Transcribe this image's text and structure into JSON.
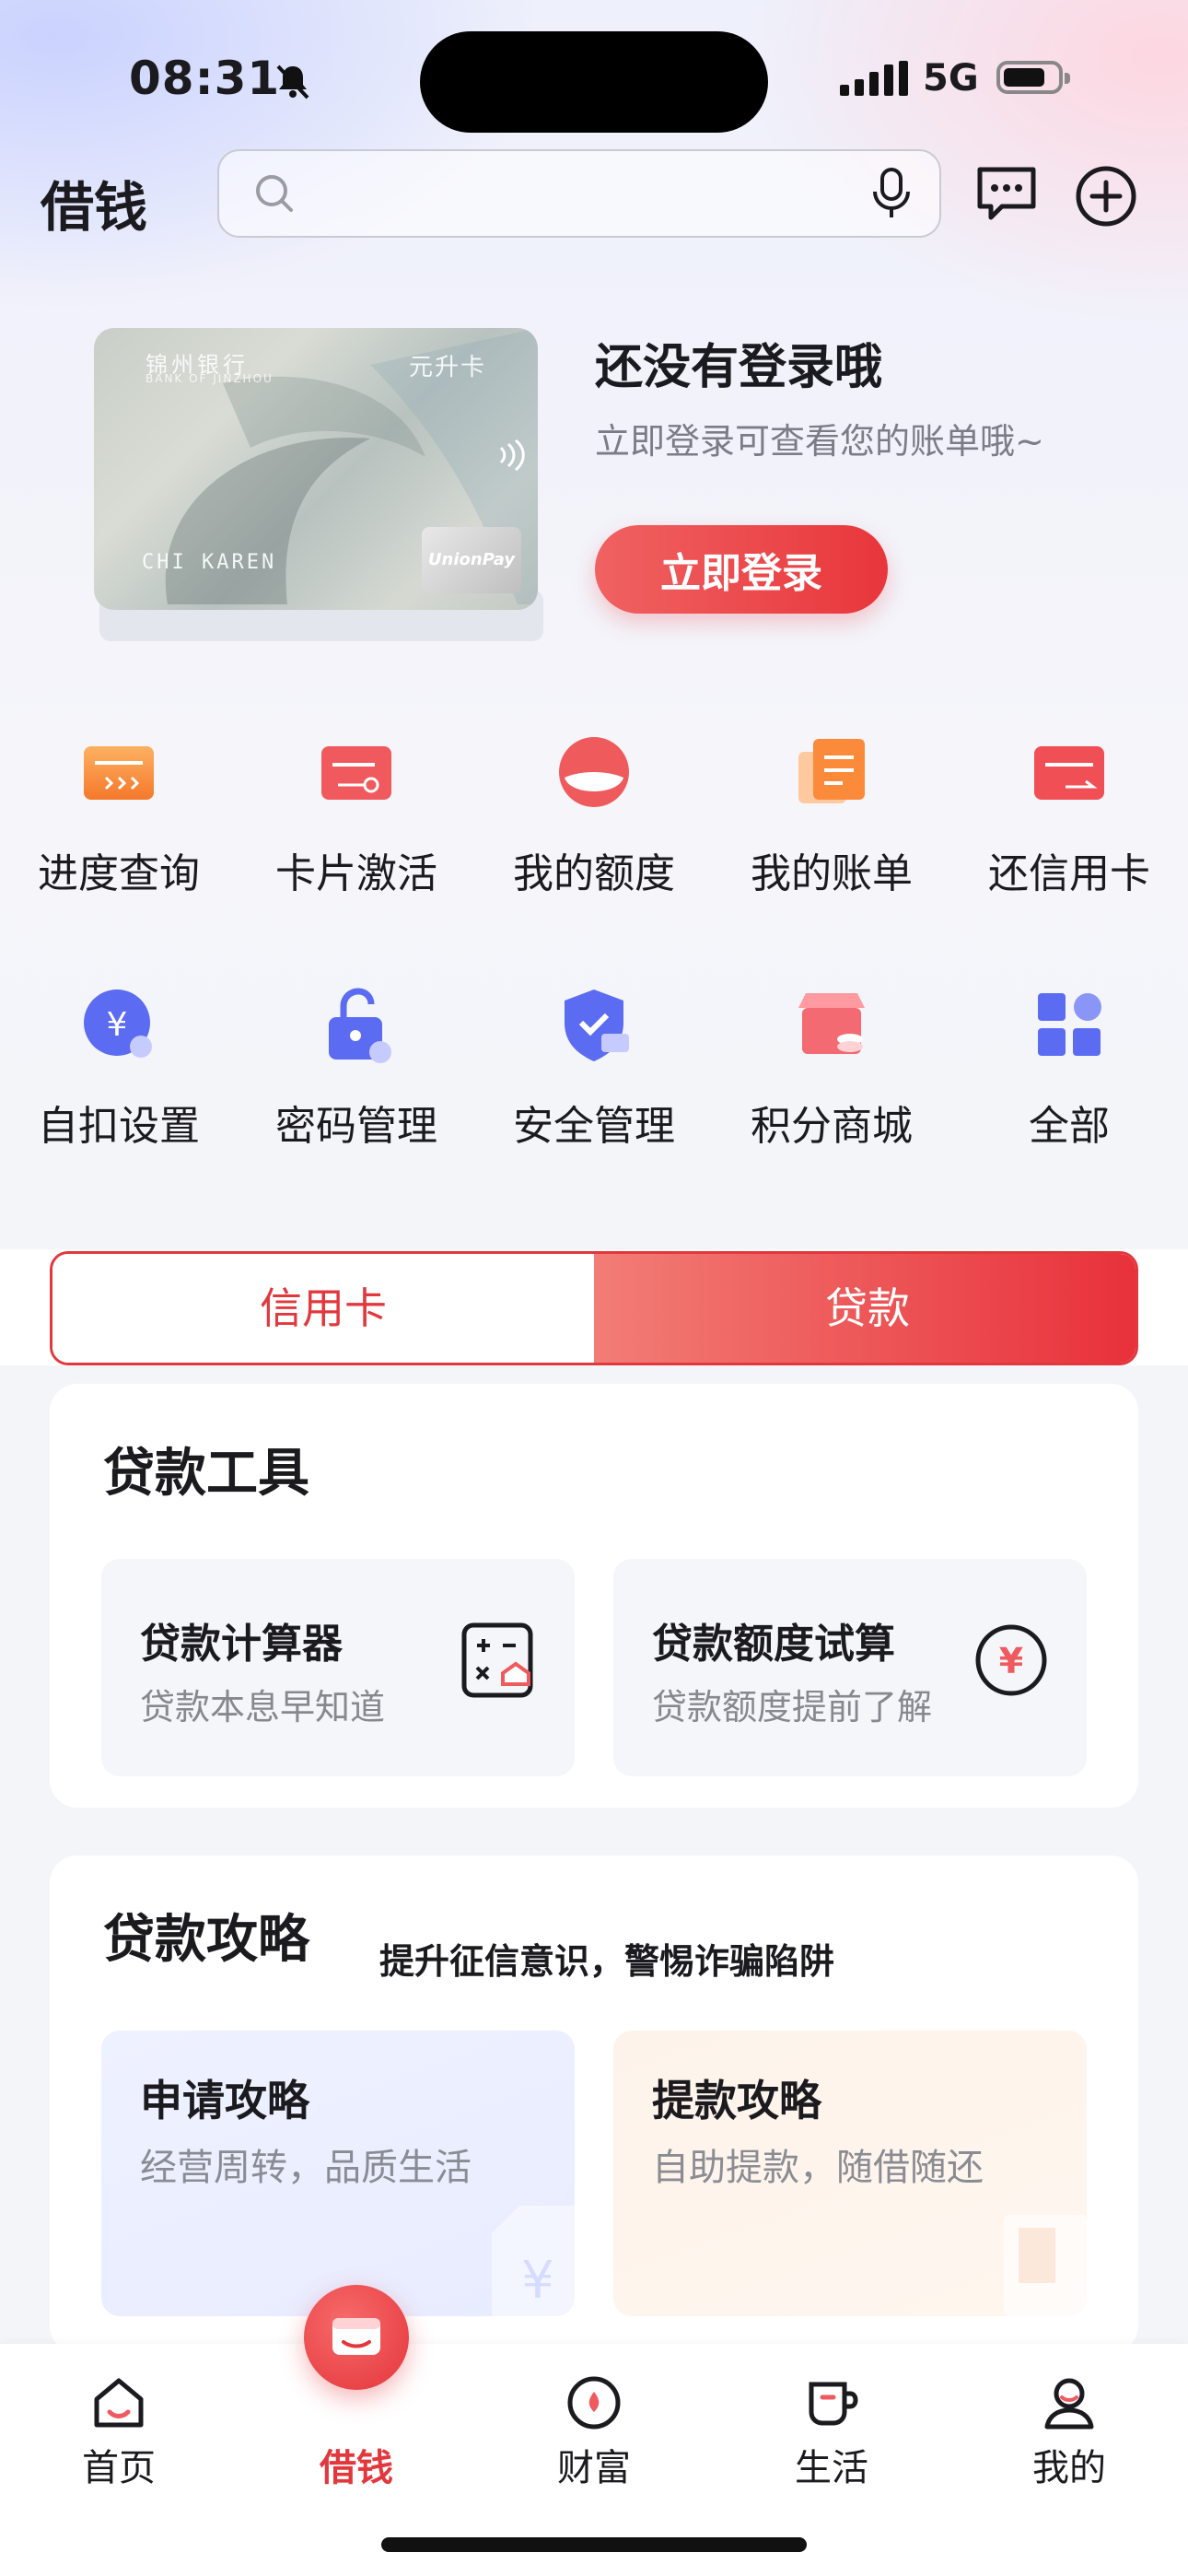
{
  "status_bar": {
    "time": "08:31",
    "network": "5G"
  },
  "header": {
    "title": "借钱",
    "search_placeholder": ""
  },
  "login_card": {
    "card_bank_name": "锦州银行",
    "card_bank_en": "BANK OF JINZHOU",
    "card_tag": "元升卡",
    "card_holder": "CHI KAREN",
    "card_network": "UnionPay 银联",
    "title": "还没有登录哦",
    "subtitle": "立即登录可查看您的账单哦~",
    "button": "立即登录"
  },
  "quick_actions": [
    {
      "label": "进度查询",
      "icon": "progress-query-icon"
    },
    {
      "label": "卡片激活",
      "icon": "card-activate-icon"
    },
    {
      "label": "我的额度",
      "icon": "credit-limit-icon"
    },
    {
      "label": "我的账单",
      "icon": "bill-icon"
    },
    {
      "label": "还信用卡",
      "icon": "repay-card-icon"
    },
    {
      "label": "自扣设置",
      "icon": "auto-debit-icon"
    },
    {
      "label": "密码管理",
      "icon": "password-lock-icon"
    },
    {
      "label": "安全管理",
      "icon": "security-shield-icon"
    },
    {
      "label": "积分商城",
      "icon": "points-mall-icon"
    },
    {
      "label": "全部",
      "icon": "all-grid-icon"
    }
  ],
  "tabs": {
    "credit_card": "信用卡",
    "loan": "贷款",
    "active": "贷款"
  },
  "loan_tools": {
    "title": "贷款工具",
    "items": [
      {
        "title": "贷款计算器",
        "subtitle": "贷款本息早知道",
        "icon": "calculator-icon"
      },
      {
        "title": "贷款额度试算",
        "subtitle": "贷款额度提前了解",
        "icon": "yuan-circle-icon"
      }
    ]
  },
  "loan_guides": {
    "title": "贷款攻略",
    "subtitle": "提升征信意识，警惕诈骗陷阱",
    "items": [
      {
        "title": "申请攻略",
        "subtitle": "经营周转，品质生活"
      },
      {
        "title": "提款攻略",
        "subtitle": "自助提款，随借随还"
      }
    ]
  },
  "bottom_nav": [
    {
      "label": "首页",
      "icon": "home-icon"
    },
    {
      "label": "借钱",
      "icon": "wallet-icon",
      "active": true
    },
    {
      "label": "财富",
      "icon": "wealth-icon"
    },
    {
      "label": "生活",
      "icon": "cup-icon"
    },
    {
      "label": "我的",
      "icon": "profile-icon"
    }
  ],
  "colors": {
    "brand_red": "#e2383d",
    "text": "#1b1b1f",
    "muted": "#86888f"
  }
}
